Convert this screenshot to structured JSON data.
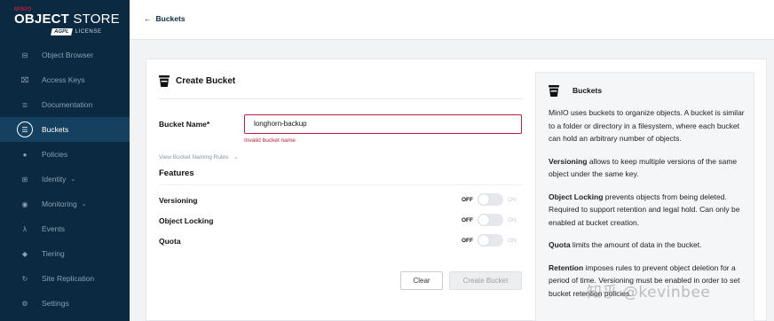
{
  "brand": {
    "small": "MINIO",
    "name_bold": "OBJECT",
    "name_rest": " STORE",
    "license_badge": "AGPL",
    "license_text": "LICENSE"
  },
  "sidebar": {
    "items": [
      {
        "label": "Object Browser",
        "icon": "object-browser-icon",
        "glyph": "⊟"
      },
      {
        "label": "Access Keys",
        "icon": "key-icon",
        "glyph": "⌧"
      },
      {
        "label": "Documentation",
        "icon": "document-icon",
        "glyph": "≣"
      },
      {
        "label": "Buckets",
        "icon": "bucket-icon",
        "glyph": "☰",
        "active": true
      },
      {
        "label": "Policies",
        "icon": "shield-icon",
        "glyph": "●"
      },
      {
        "label": "Identity",
        "icon": "identity-icon",
        "glyph": "⊞",
        "caret": "⌄"
      },
      {
        "label": "Monitoring",
        "icon": "search-icon",
        "glyph": "◉",
        "caret": "⌄"
      },
      {
        "label": "Events",
        "icon": "lambda-icon",
        "glyph": "λ"
      },
      {
        "label": "Tiering",
        "icon": "tiering-icon",
        "glyph": "◆"
      },
      {
        "label": "Site Replication",
        "icon": "replication-icon",
        "glyph": "↻"
      },
      {
        "label": "Settings",
        "icon": "gear-icon",
        "glyph": "⚙"
      }
    ]
  },
  "header": {
    "back_arrow": "←",
    "back_label": "Buckets"
  },
  "form": {
    "title": "Create Bucket",
    "bucket_name_label": "Bucket Name*",
    "bucket_name_value": "longhorn-backup",
    "error_text": "Invalid bucket name",
    "naming_rules": "View Bucket Naming Rules",
    "naming_caret": "⌄",
    "features_title": "Features",
    "features": [
      {
        "label": "Versioning",
        "off": "OFF",
        "on": "ON"
      },
      {
        "label": "Object Locking",
        "off": "OFF",
        "on": "ON"
      },
      {
        "label": "Quota",
        "off": "OFF",
        "on": "ON"
      }
    ],
    "clear_label": "Clear",
    "create_label": "Create Bucket"
  },
  "help": {
    "title": "Buckets",
    "intro": "MinIO uses buckets to organize objects. A bucket is similar to a folder or directory in a filesystem, where each bucket can hold an arbitrary number of objects.",
    "versioning_term": "Versioning",
    "versioning_text": " allows to keep multiple versions of the same object under the same key.",
    "locking_term": "Object Locking",
    "locking_text": " prevents objects from being deleted. Required to support retention and legal hold. Can only be enabled at bucket creation.",
    "quota_term": "Quota",
    "quota_text": " limits the amount of data in the bucket.",
    "retention_term": "Retention",
    "retention_text": " imposes rules to prevent object deletion for a period of time. Versioning must be enabled in order to set bucket retention policies."
  },
  "watermark": "知乎 @kevinbee",
  "colors": {
    "sidebar_bg": "#0b2940",
    "active_bg": "#15405f",
    "error": "#c51c3e"
  }
}
